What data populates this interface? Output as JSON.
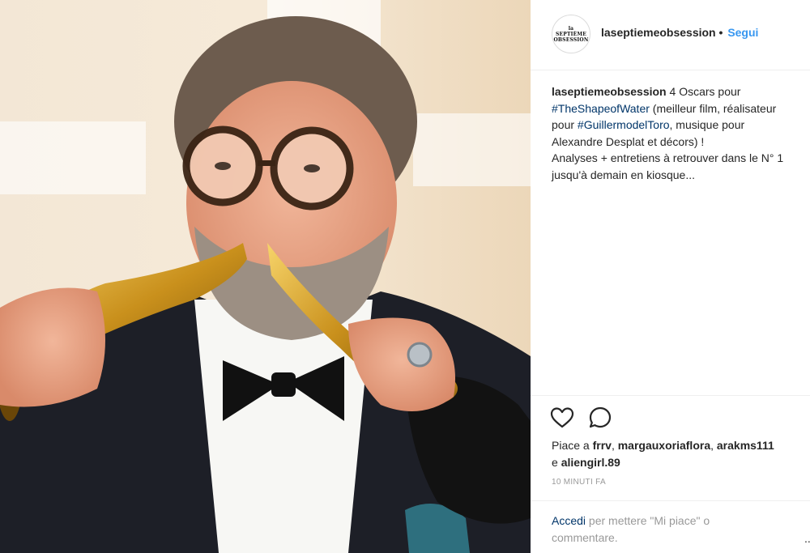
{
  "photo": {
    "alt": ""
  },
  "header": {
    "avatar_lines": [
      "la",
      "SEPTIÈME",
      "OBSESSION"
    ],
    "username": "laseptiemeobsession",
    "dot": "•",
    "follow_label": "Segui"
  },
  "caption": {
    "username": "laseptiemeobsession",
    "t1": " 4 Oscars pour",
    "tag1": "#TheShapeofWater",
    "t2": " (meilleur film, réalisateur",
    "t3": "pour ",
    "tag2": "#GuillermodelToro",
    "t4": ", musique pour",
    "t5": "Alexandre Desplat et décors) !",
    "t6": "Analyses + entretiens à retrouver dans le N° 1",
    "t7": "jusqu'à demain en kiosque..."
  },
  "actions": {
    "like_icon": "heart-icon",
    "comment_icon": "comment-icon"
  },
  "likes": {
    "prefix": "Piace a ",
    "users": [
      "frrv",
      "margauxoriaflora",
      "arakms111"
    ],
    "sep": ", ",
    "and": "e ",
    "last_user": "aliengirl.89"
  },
  "timestamp": "10 MINUTI FA",
  "login": {
    "link": "Accedi",
    "text": " per mettere \"Mi piace\" o",
    "text2": "commentare.",
    "more": "..."
  },
  "colors": {
    "link": "#003569",
    "follow": "#3897f0",
    "muted": "#999999",
    "divider": "#efefef"
  }
}
